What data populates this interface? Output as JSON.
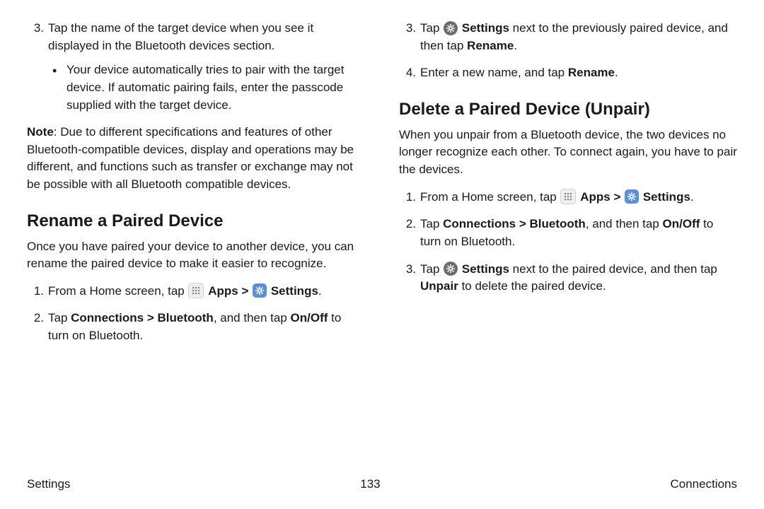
{
  "left": {
    "step3": {
      "num": "3.",
      "text": "Tap the name of the target device when you see it displayed in the Bluetooth devices section.",
      "bullet": "Your device automatically tries to pair with the target device. If automatic pairing fails, enter the passcode supplied with the target device."
    },
    "note": {
      "label": "Note",
      "text": ": Due to different specifications and features of other Bluetooth-compatible devices, display and operations may be different, and functions such as transfer or exchange may not be possible with all Bluetooth compatible devices."
    },
    "rename": {
      "heading": "Rename a Paired Device",
      "intro": "Once you have paired your device to another device, you can rename the paired device to make it easier to recognize.",
      "s1": {
        "num": "1.",
        "pre": "From a Home screen, tap ",
        "apps": "Apps",
        "chev": ">",
        "settings": "Settings",
        "post": "."
      },
      "s2": {
        "num": "2.",
        "pre": "Tap ",
        "b1": "Connections",
        "chev": ">",
        "b2": "Bluetooth",
        "mid": ", and then tap ",
        "b3": "On/Off",
        "post": " to turn on Bluetooth."
      }
    }
  },
  "right": {
    "s3": {
      "num": "3.",
      "pre": "Tap ",
      "b1": "Settings",
      "mid": " next to the previously paired device, and then tap ",
      "b2": "Rename",
      "post": "."
    },
    "s4": {
      "num": "4.",
      "pre": "Enter a new name, and tap ",
      "b1": "Rename",
      "post": "."
    },
    "del": {
      "heading": "Delete a Paired Device (Unpair)",
      "intro": "When you unpair from a Bluetooth device, the two devices no longer recognize each other. To connect again, you have to pair the devices.",
      "s1": {
        "num": "1.",
        "pre": "From a Home screen, tap ",
        "apps": "Apps",
        "chev": ">",
        "settings": "Settings",
        "post": "."
      },
      "s2": {
        "num": "2.",
        "pre": "Tap ",
        "b1": "Connections",
        "chev": ">",
        "b2": "Bluetooth",
        "mid": ", and then tap ",
        "b3": "On/Off",
        "post": " to turn on Bluetooth."
      },
      "s3": {
        "num": "3.",
        "pre": "Tap ",
        "b1": "Settings",
        "mid": " next to the paired device, and then tap ",
        "b2": "Unpair",
        "post": " to delete the paired device."
      }
    }
  },
  "footer": {
    "left": "Settings",
    "center": "133",
    "right": "Connections"
  }
}
